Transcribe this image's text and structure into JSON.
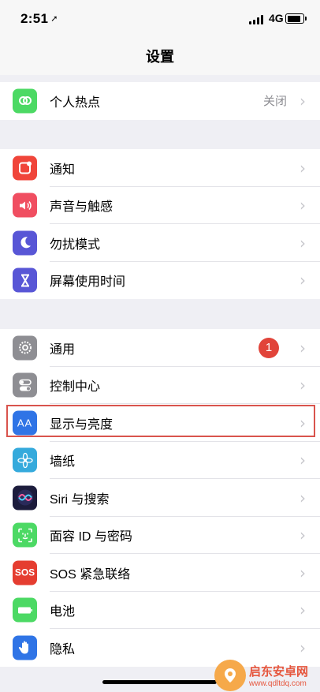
{
  "status": {
    "time": "2:51",
    "network": "4G"
  },
  "nav": {
    "title": "设置"
  },
  "groups": [
    {
      "items": [
        {
          "label": "个人热点",
          "value": "关闭",
          "icon": "hotspot-icon",
          "color": "#4cd964"
        }
      ]
    },
    {
      "items": [
        {
          "label": "通知",
          "icon": "notifications-icon",
          "color": "#f0453a"
        },
        {
          "label": "声音与触感",
          "icon": "sound-icon",
          "color": "#f04e61"
        },
        {
          "label": "勿扰模式",
          "icon": "moon-icon",
          "color": "#5856d6"
        },
        {
          "label": "屏幕使用时间",
          "icon": "hourglass-icon",
          "color": "#5856d6"
        }
      ]
    },
    {
      "items": [
        {
          "label": "通用",
          "badge": "1",
          "icon": "gear-icon",
          "color": "#8e8e93"
        },
        {
          "label": "控制中心",
          "icon": "toggles-icon",
          "color": "#8e8e93"
        },
        {
          "label": "显示与亮度",
          "icon": "display-icon",
          "color": "#2f74e6",
          "icon_text": "AA"
        },
        {
          "label": "墙纸",
          "icon": "wallpaper-icon",
          "color": "#35aadc"
        },
        {
          "label": "Siri 与搜索",
          "icon": "siri-icon",
          "color": "#1c1c3c"
        },
        {
          "label": "面容 ID 与密码",
          "icon": "faceid-icon",
          "color": "#4cd964"
        },
        {
          "label": "SOS 紧急联络",
          "icon": "sos-icon",
          "color": "#e53d30",
          "icon_text": "SOS"
        },
        {
          "label": "电池",
          "icon": "battery-icon",
          "color": "#4cd964"
        },
        {
          "label": "隐私",
          "icon": "hand-icon",
          "color": "#2f74e6"
        }
      ]
    }
  ],
  "watermark": {
    "name": "启东安卓网",
    "url": "www.qdltdq.com"
  }
}
